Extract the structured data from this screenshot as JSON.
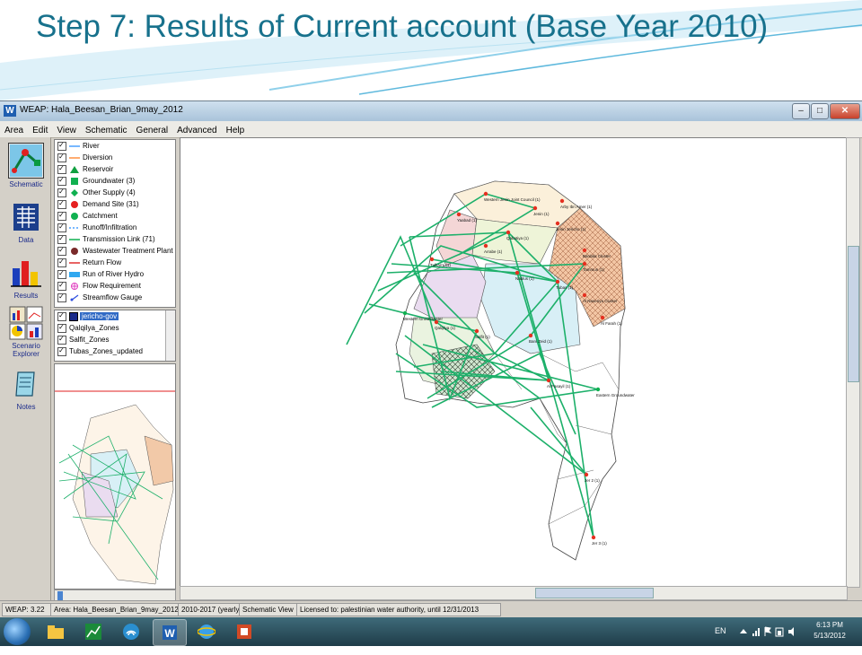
{
  "slide": {
    "title": "Step 7: Results of Current account (Base Year 2010)"
  },
  "window": {
    "title": "WEAP: Hala_Beesan_Brian_9may_2012",
    "app_icon": "W"
  },
  "menu": [
    "Area",
    "Edit",
    "View",
    "Schematic",
    "General",
    "Advanced",
    "Help"
  ],
  "toolbar": [
    {
      "label": "Schematic",
      "icon": "schematic-icon"
    },
    {
      "label": "Data",
      "icon": "data-icon"
    },
    {
      "label": "Results",
      "icon": "results-icon"
    },
    {
      "label": "Scenario Explorer",
      "icon": "scenario-explorer-icon"
    },
    {
      "label": "Notes",
      "icon": "notes-icon"
    }
  ],
  "legend": [
    {
      "label": "River",
      "sym": "line-blue"
    },
    {
      "label": "Diversion",
      "sym": "line-orange"
    },
    {
      "label": "Reservoir",
      "sym": "triangle-green"
    },
    {
      "label": "Groundwater (3)",
      "sym": "square-green"
    },
    {
      "label": "Other Supply (4)",
      "sym": "diamond-green"
    },
    {
      "label": "Demand Site (31)",
      "sym": "circle-red"
    },
    {
      "label": "Catchment",
      "sym": "circle-green"
    },
    {
      "label": "Runoff/Infiltration",
      "sym": "dash-blue"
    },
    {
      "label": "Transmission Link (71)",
      "sym": "line-green"
    },
    {
      "label": "Wastewater Treatment Plant",
      "sym": "circle-brown"
    },
    {
      "label": "Return Flow",
      "sym": "line-red"
    },
    {
      "label": "Run of River Hydro",
      "sym": "bar-blue"
    },
    {
      "label": "Flow Requirement",
      "sym": "flow-pink"
    },
    {
      "label": "Streamflow Gauge",
      "sym": "gauge-blue"
    }
  ],
  "layers": [
    {
      "label": "jericho-gov",
      "selected": true
    },
    {
      "label": "Qalqilya_Zones",
      "selected": false
    },
    {
      "label": "Salfit_Zones",
      "selected": false
    },
    {
      "label": "Tubas_Zones_updated",
      "selected": false
    }
  ],
  "map": {
    "nodes": [
      {
        "label": "Western Jenin Joint Council (1)"
      },
      {
        "label": "Jenin (1)"
      },
      {
        "label": "Arby Ibn Amer (1)"
      },
      {
        "label": "Yaabad (1)"
      },
      {
        "label": "Qabatiya (1)"
      },
      {
        "label": "Jenin Jericho (1)"
      },
      {
        "label": "Arrabe (1)"
      },
      {
        "label": "Tulkarm (1)"
      },
      {
        "label": "Bardala Cluster"
      },
      {
        "label": "Tammun (1)"
      },
      {
        "label": "Nablus (1)"
      },
      {
        "label": "Tubas (1)"
      },
      {
        "label": "Al Naseriya Cluster"
      },
      {
        "label": "Al Farah (1)"
      },
      {
        "label": "Salfit (1)"
      },
      {
        "label": "Qalqilya (1)"
      },
      {
        "label": "Bani Zeid (1)"
      },
      {
        "label": "Al Fasayil (1)"
      },
      {
        "label": "Jer 2 (1)"
      },
      {
        "label": "Jer 3 (1)"
      },
      {
        "label": "Eastern Groundwater"
      },
      {
        "label": "Western Groundwater"
      }
    ]
  },
  "status": [
    "WEAP: 3.22",
    "Area: Hala_Beesan_Brian_9may_2012",
    "2010-2017 (yearly)",
    "Schematic View",
    "Licensed to: palestinian water authority, until 12/31/2013"
  ],
  "taskbar": {
    "apps": [
      "explorer-icon",
      "chart-app-icon",
      "network-icon",
      "word-icon",
      "ie-icon",
      "powerpoint-icon"
    ],
    "lang": "EN",
    "time": "6:13 PM",
    "date": "5/13/2012"
  },
  "colors": {
    "title": "#17718c",
    "link": "#1db06a",
    "demand": "#e53020"
  }
}
